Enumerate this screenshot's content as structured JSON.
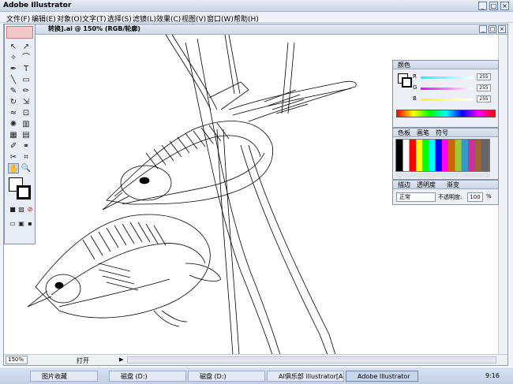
{
  "app": {
    "title": "Adobe Illustrator"
  },
  "menu": [
    "文件(F)",
    "编辑(E)",
    "对象(O)",
    "文字(T)",
    "选择(S)",
    "滤镜(L)",
    "效果(C)",
    "视图(V)",
    "窗口(W)",
    "帮助(H)"
  ],
  "document": {
    "title": "转换].ai @ 150% (RGB/轮廓)",
    "zoom": "150%",
    "status": "打开"
  },
  "color_panel": {
    "tab": "颜色",
    "channels": [
      {
        "label": "R",
        "value": "255"
      },
      {
        "label": "G",
        "value": "255"
      },
      {
        "label": "B",
        "value": "255"
      }
    ]
  },
  "swatch_panel": {
    "tabs": [
      "色板",
      "画笔",
      "符号"
    ]
  },
  "transparency_panel": {
    "tabs": [
      "描边",
      "透明度",
      "渐变"
    ],
    "blend_mode": "正常",
    "opacity_label": "不透明度:",
    "opacity_value": "100",
    "percent": "%"
  },
  "taskbar": {
    "items": [
      "图片收藏",
      "磁盘 (D:)",
      "磁盘 (D:)",
      "AI俱乐部 illustrator[A...",
      "Adobe Illustrator"
    ],
    "clock": "9:16"
  }
}
